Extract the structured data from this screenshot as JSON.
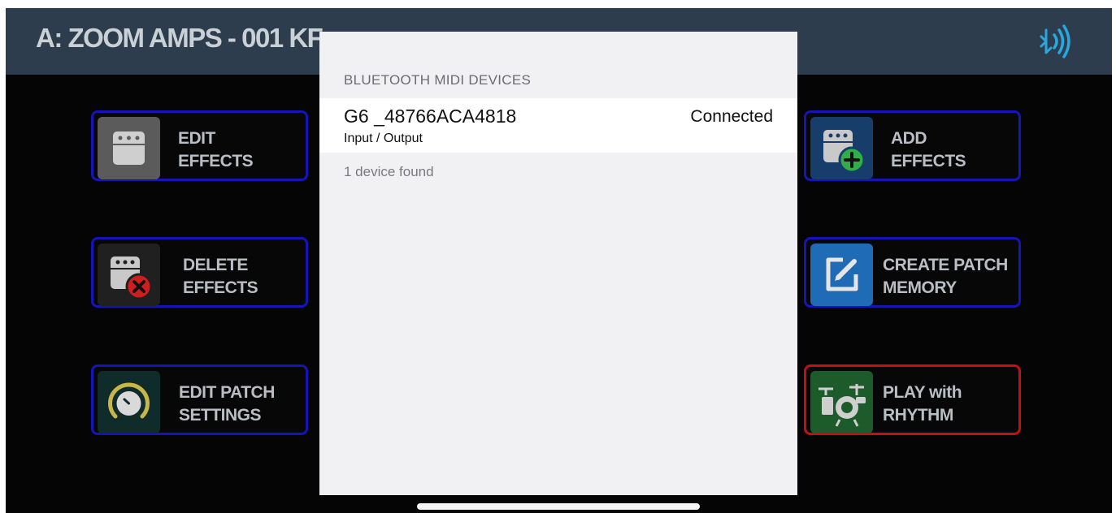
{
  "header": {
    "title": "A: ZOOM AMPS - 001 KF",
    "bluetooth_icon": "bluetooth-signal-icon"
  },
  "tiles": {
    "edit_effects": {
      "line1": "EDIT",
      "line2": "EFFECTS",
      "icon": "effect-pedal-icon"
    },
    "delete_effects": {
      "line1": "DELETE",
      "line2": "EFFECTS",
      "icon": "delete-effect-icon"
    },
    "edit_patch_settings": {
      "line1": "EDIT PATCH",
      "line2": "SETTINGS",
      "icon": "knob-icon"
    },
    "add_effects": {
      "line1": "ADD",
      "line2": "EFFECTS",
      "icon": "add-effect-icon"
    },
    "create_patch_memory": {
      "line1": "CREATE PATCH",
      "line2": "MEMORY",
      "icon": "edit-pencil-icon"
    },
    "play_with_rhythm": {
      "line1": "PLAY with",
      "line2": "RHYTHM",
      "icon": "drum-kit-icon"
    }
  },
  "bluetooth_panel": {
    "section_header": "BLUETOOTH MIDI DEVICES",
    "devices": [
      {
        "name": "G6 _48766ACA4818",
        "subtitle": "Input / Output",
        "status": "Connected"
      }
    ],
    "found_text": "1 device found"
  },
  "colors": {
    "header_bg": "#2e3d4d",
    "tile_border_blue": "#1414b8",
    "tile_border_red": "#c01212",
    "accent_blue": "#2a8ad4",
    "accent_green": "#2fae4a",
    "accent_red": "#d01e1e"
  }
}
